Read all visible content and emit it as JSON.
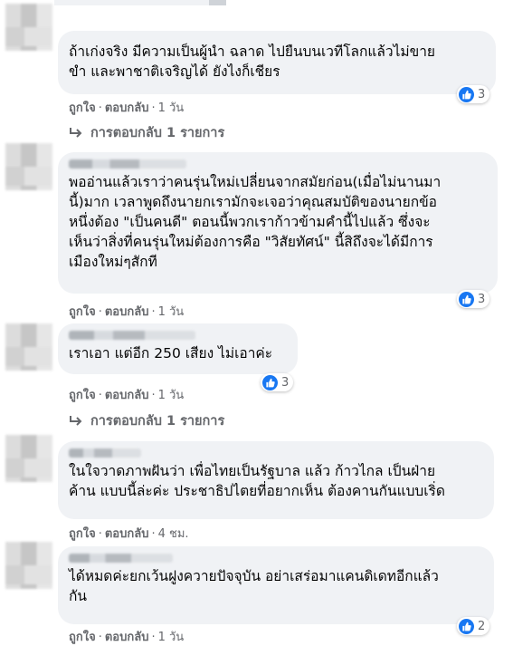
{
  "colors": {
    "bubble": "#f0f2f5",
    "meta_text": "#65676b",
    "like_blue": "#1877f2"
  },
  "actions": {
    "like": "ถูกใจ",
    "reply": "ตอบกลับ"
  },
  "comments": [
    {
      "text": "ถ้าเก่งจริง มีความเป็นผู้นำ ฉลาด ไปยืนบนเวทีโลกแล้วไม่ขาย\nขำ และพาชาติเจริญได้ ยังไงก็เชียร",
      "reactions": "3",
      "time": "1 วัน",
      "replies": "การตอบกลับ 1 รายการ"
    },
    {
      "text": "พออ่านแล้วเราว่าคนรุ่นใหม่เปลี่ยนจากสมัยก่อน(เมื่อไม่นานมา\nนี้)มาก เวลาพูดถึงนายกเรามักจะเจอว่าคุณสมบัติของนายกข้อ\nหนึ่งต้อง \"เป็นคนดี\" ตอนนี้พวกเราก้าวข้ามคำนี้ไปแล้ว ซึ่งจะ\nเห็นว่าสิ่งที่คนรุ่นใหม่ต้องการคือ \"วิสัยทัศน์\" นี้สิถึงจะได้มีการ\nเมืองใหม่ๆสักที",
      "reactions": "3",
      "time": "1 วัน"
    },
    {
      "text": "เราเอา แต่อีก 250 เสียง ไม่เอาค่ะ",
      "reactions": "3",
      "time": "1 วัน",
      "replies": "การตอบกลับ 1 รายการ"
    },
    {
      "text": "ในใจวาดภาพฝันว่า เพื่อไทยเป็นรัฐบาล แล้ว ก้าวไกล เป็นฝ่าย\nค้าน แบบนี้ล่ะค่ะ ประชาธิปไตยที่อยากเห็น ต้องคานกันแบบเริ่ด",
      "time": "4 ชม."
    },
    {
      "text": "ได้หมดค่ะยกเว้นฝูงควายปัจจุบัน อย่าเสร่อมาแคนดิเดทอีกแล้ว\nกัน",
      "reactions": "2",
      "time": "1 วัน"
    }
  ]
}
